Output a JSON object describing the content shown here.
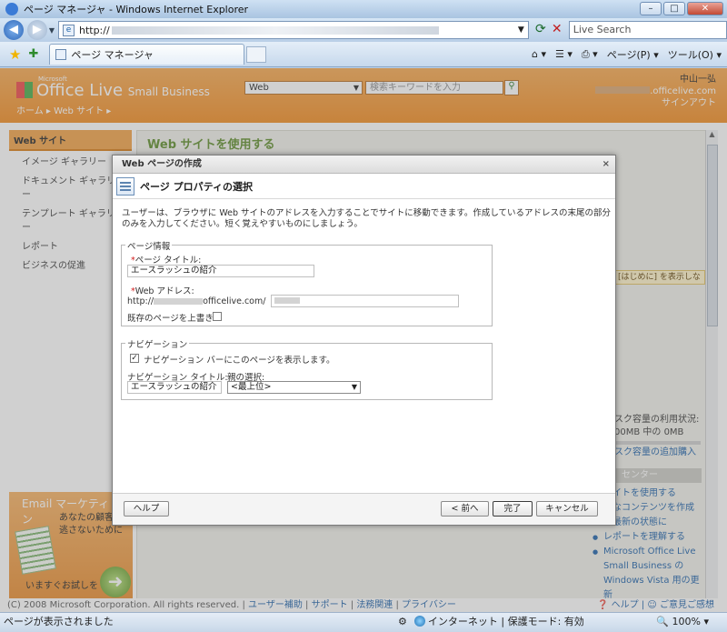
{
  "window": {
    "title": "ページ マネージャ - Windows Internet Explorer",
    "minimize": "–",
    "maximize": "□",
    "close": "✕"
  },
  "address": {
    "url_prefix": "http://",
    "search_placeholder": "Live Search"
  },
  "tabs": {
    "active_label": "ページ マネージャ",
    "page_menu": "ページ(P) ▾",
    "tools_menu": "ツール(O) ▾"
  },
  "site": {
    "ms_label": "Microsoft",
    "logo_main": "Office Live",
    "logo_sub": "Small Business",
    "scope_select": "Web",
    "keyword_placeholder": "検索キーワードを入力",
    "user_name": "中山一弘",
    "user_domain_suffix": ".officelive.com",
    "signout": "サインアウト",
    "breadcrumb_home": "ホーム",
    "breadcrumb_web": "Web サイト"
  },
  "leftnav": {
    "header": "Web サイト",
    "items": [
      "イメージ ギャラリー",
      "ドキュメント ギャラリー",
      "テンプレート ギャラリー",
      "レポート",
      "ビジネスの促進"
    ]
  },
  "main": {
    "title": "Web サイトを使用する",
    "hint": "[はじめに] を表示しな",
    "disk_usage_label": "スク容量の利用状況:",
    "disk_usage_value": "00MB 中の 0MB",
    "disk_buy": "スク容量の追加購入",
    "center_header": "センター",
    "center_links": [
      "サイトを使用する",
      "的なコンテンツを作成",
      "に最新の状態に",
      "レポートを理解する",
      "Microsoft Office Live",
      "Small Business の",
      "Windows Vista 用の更新"
    ]
  },
  "ad": {
    "title": "Email マーケティン",
    "line1": "あなたの顧客を",
    "line2": "逃さないために",
    "cta": "いますぐお試しを"
  },
  "footer": {
    "copyright": "(C) 2008 Microsoft Corporation. All rights reserved.",
    "links": [
      "ユーザー補助",
      "サポート",
      "法務関連",
      "プライバシー"
    ],
    "help": "ヘルプ",
    "feedback": "ご意見ご感想"
  },
  "dialog": {
    "title": "Web ページの作成",
    "close": "×",
    "step_title": "ページ プロパティの選択",
    "description": "ユーザーは、ブラウザに Web サイトのアドレスを入力することでサイトに移動できます。作成しているアドレスの末尾の部分のみを入力してください。短く覚えやすいものにしましょう。",
    "page_info": {
      "legend": "ページ情報",
      "title_label": "ページ タイトル:",
      "title_value": "エースラッシュの紹介",
      "address_label": "Web アドレス:",
      "address_prefix": "http://",
      "address_domain": "officelive.com/",
      "overwrite_label": "既存のページを上書き:"
    },
    "navigation": {
      "legend": "ナビゲーション",
      "show_label": "ナビゲーション バーにこのページを表示します。",
      "show_checked": "✓",
      "nav_title_label": "ナビゲーション タイトル:",
      "nav_title_value": "エースラッシュの紹介",
      "parent_label": "親の選択:",
      "parent_value": "<最上位>"
    },
    "buttons": {
      "help": "ヘルプ",
      "back": "< 前へ",
      "finish": "完了",
      "cancel": "キャンセル"
    }
  },
  "status": {
    "text": "ページが表示されました",
    "zone": "インターネット | 保護モード: 有効",
    "zoom": "100%"
  }
}
